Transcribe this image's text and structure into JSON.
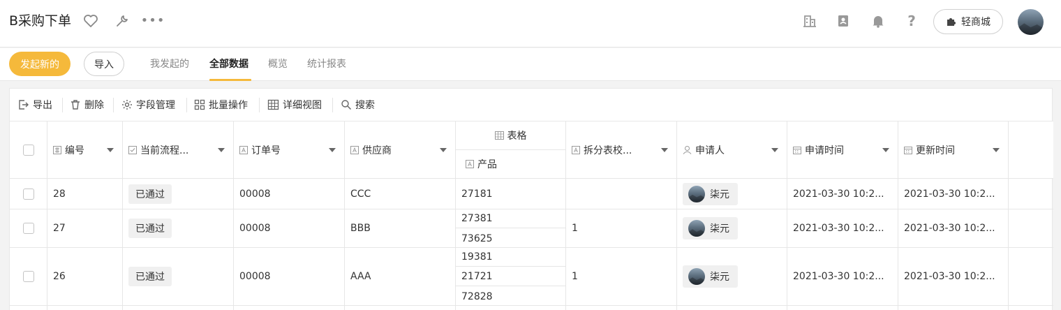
{
  "header": {
    "title": "B采购下单",
    "shop_label": "轻商城"
  },
  "tabbar": {
    "new_label": "发起新的",
    "import_label": "导入",
    "tabs": [
      {
        "label": "我发起的"
      },
      {
        "label": "全部数据"
      },
      {
        "label": "概览"
      },
      {
        "label": "统计报表"
      }
    ]
  },
  "toolbar": {
    "export": "导出",
    "delete": "删除",
    "fields": "字段管理",
    "batch": "批量操作",
    "detail_view": "详细视图",
    "search": "搜索"
  },
  "table": {
    "columns": {
      "id": "编号",
      "flow": "当前流程...",
      "order": "订单号",
      "supplier": "供应商",
      "table_group": "表格",
      "product": "产品",
      "split": "拆分表校...",
      "applicant": "申请人",
      "apply_time": "申请时间",
      "update_time": "更新时间"
    },
    "rows": [
      {
        "id": "28",
        "status": "已通过",
        "order": "00008",
        "supplier": "CCC",
        "products": [
          "27181"
        ],
        "split": "",
        "user": "柒元",
        "apply_time": "2021-03-30 10:2...",
        "update_time": "2021-03-30 10:2..."
      },
      {
        "id": "27",
        "status": "已通过",
        "order": "00008",
        "supplier": "BBB",
        "products": [
          "27381",
          "73625"
        ],
        "split": "1",
        "user": "柒元",
        "apply_time": "2021-03-30 10:2...",
        "update_time": "2021-03-30 10:2..."
      },
      {
        "id": "26",
        "status": "已通过",
        "order": "00008",
        "supplier": "AAA",
        "products": [
          "19381",
          "21721",
          "72828"
        ],
        "split": "1",
        "user": "柒元",
        "apply_time": "2021-03-30 10:2...",
        "update_time": "2021-03-30 10:2..."
      }
    ]
  },
  "colors": {
    "accent": "#f5b93b",
    "border": "#e6e6e6",
    "badge_bg": "#f0f0f0"
  }
}
